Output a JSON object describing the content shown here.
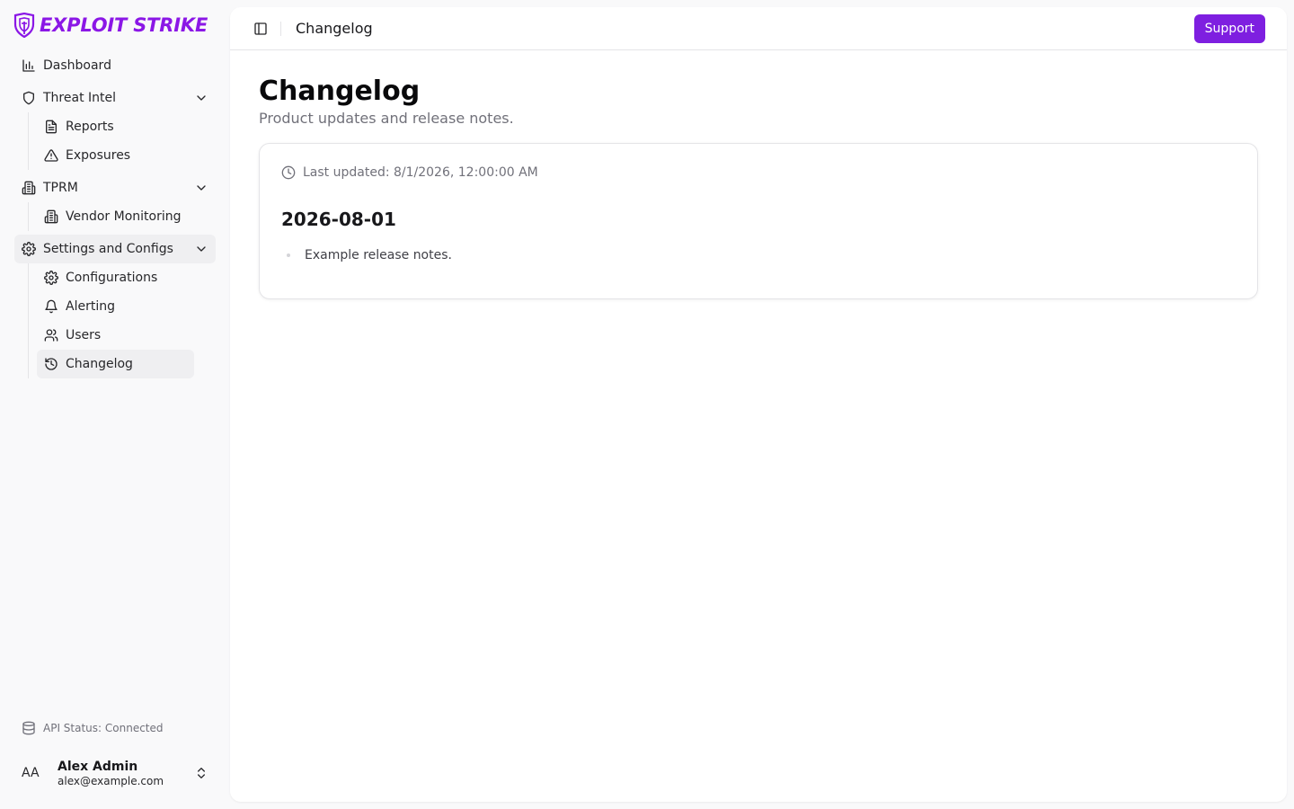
{
  "brand": {
    "name": "EXPLOIT STRIKE",
    "color": "#8b17e6"
  },
  "sidebar": {
    "items": [
      {
        "label": "Dashboard",
        "icon": "bar-chart-icon"
      },
      {
        "label": "Threat Intel",
        "icon": "shield-icon",
        "expanded": true,
        "children": [
          {
            "label": "Reports",
            "icon": "file-text-icon"
          },
          {
            "label": "Exposures",
            "icon": "alert-triangle-icon"
          }
        ]
      },
      {
        "label": "TPRM",
        "icon": "building-icon",
        "expanded": true,
        "children": [
          {
            "label": "Vendor Monitoring",
            "icon": "building-icon"
          }
        ]
      },
      {
        "label": "Settings and Configs",
        "icon": "gear-icon",
        "expanded": true,
        "active": true,
        "children": [
          {
            "label": "Configurations",
            "icon": "gear-icon"
          },
          {
            "label": "Alerting",
            "icon": "bell-icon"
          },
          {
            "label": "Users",
            "icon": "users-icon"
          },
          {
            "label": "Changelog",
            "icon": "history-icon",
            "active": true
          }
        ]
      }
    ],
    "api_status": "API Status: Connected",
    "user": {
      "initials": "AA",
      "name": "Alex Admin",
      "email": "alex@example.com"
    }
  },
  "header": {
    "title": "Changelog",
    "support_label": "Support",
    "accent": "#7e1fe0"
  },
  "main": {
    "title": "Changelog",
    "subtitle": "Product updates and release notes.",
    "last_updated": "Last updated: 8/1/2026, 12:00:00 AM",
    "releases": [
      {
        "date": "2026-08-01",
        "notes": [
          "Example release notes."
        ]
      }
    ]
  }
}
